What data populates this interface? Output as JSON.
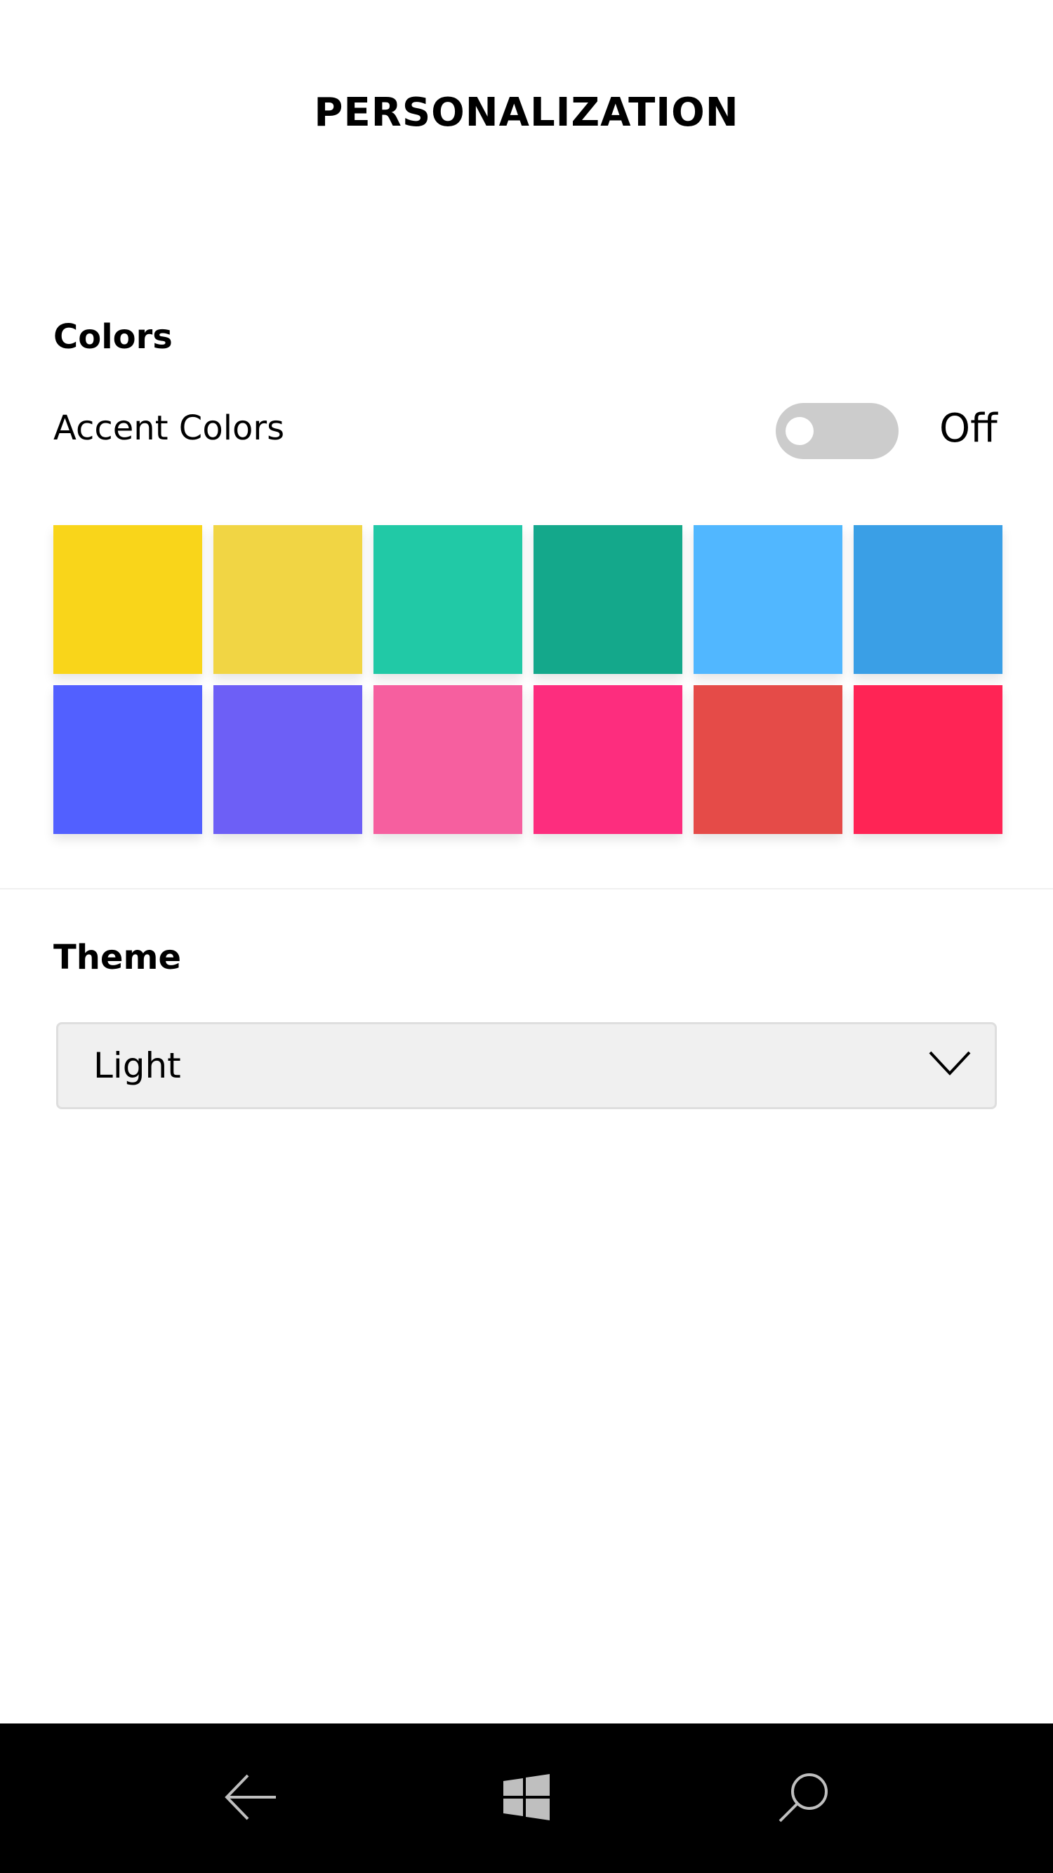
{
  "header": {
    "title": "PERSONALIZATION"
  },
  "colors": {
    "heading": "Colors",
    "accent_label": "Accent Colors",
    "accent_toggle_state": "Off",
    "swatches": [
      "#F9D51A",
      "#F1D544",
      "#21C9A6",
      "#14A88B",
      "#51B7FF",
      "#3A9FE6",
      "#5260FF",
      "#6D5FF6",
      "#F65F9F",
      "#FD2D7E",
      "#E54B48",
      "#FF2455"
    ]
  },
  "theme": {
    "heading": "Theme",
    "selected_value": "Light"
  },
  "navigation": {
    "icons": [
      "back-arrow-icon",
      "windows-start-icon",
      "search-icon"
    ]
  }
}
